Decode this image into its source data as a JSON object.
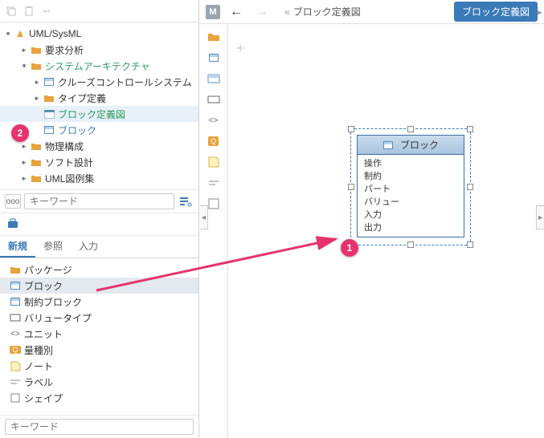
{
  "tree": {
    "root": "UML/SysML",
    "items": [
      {
        "label": "要求分析",
        "depth": 1,
        "folder": true,
        "closed": true
      },
      {
        "label": "システムアーキテクチャ",
        "depth": 1,
        "folder": true,
        "open": true,
        "green": true
      },
      {
        "label": "クルーズコントロールシステム",
        "depth": 2,
        "block": true,
        "closed": true
      },
      {
        "label": "タイプ定義",
        "depth": 2,
        "folder": true,
        "closed": true
      },
      {
        "label": "ブロック定義図",
        "depth": 2,
        "diagram": true,
        "green": true,
        "selected": true
      },
      {
        "label": "ブロック",
        "depth": 2,
        "block": true,
        "blue": true
      },
      {
        "label": "物理構成",
        "depth": 1,
        "folder": true,
        "closed": true
      },
      {
        "label": "ソフト設計",
        "depth": 1,
        "folder": true,
        "closed": true
      },
      {
        "label": "UML図例集",
        "depth": 1,
        "folder": true,
        "closed": true
      }
    ]
  },
  "search": {
    "label": "ooo",
    "placeholder": "キーワード"
  },
  "tabs": {
    "t1": "新規",
    "t2": "参照",
    "t3": "入力"
  },
  "palette": [
    {
      "label": "パッケージ",
      "icon": "folder"
    },
    {
      "label": "ブロック",
      "icon": "block",
      "selected": true
    },
    {
      "label": "制約ブロック",
      "icon": "block"
    },
    {
      "label": "バリュータイプ",
      "icon": "rect"
    },
    {
      "label": "ユニット",
      "icon": "unit"
    },
    {
      "label": "量種別",
      "icon": "qty"
    },
    {
      "label": "ノート",
      "icon": "note"
    },
    {
      "label": "ラベル",
      "icon": "label"
    },
    {
      "label": "シェイプ",
      "icon": "shape"
    }
  ],
  "bottomSearch": {
    "placeholder": "キーワード"
  },
  "mainToolbar": {
    "badge": "M",
    "breadcrumb": "ブロック定義図",
    "button": "ブロック定義図"
  },
  "block": {
    "title": "ブロック",
    "rows": [
      "操作",
      "制約",
      "パート",
      "バリュー",
      "入力",
      "出力"
    ]
  },
  "badges": {
    "b1": "1",
    "b2": "2"
  }
}
